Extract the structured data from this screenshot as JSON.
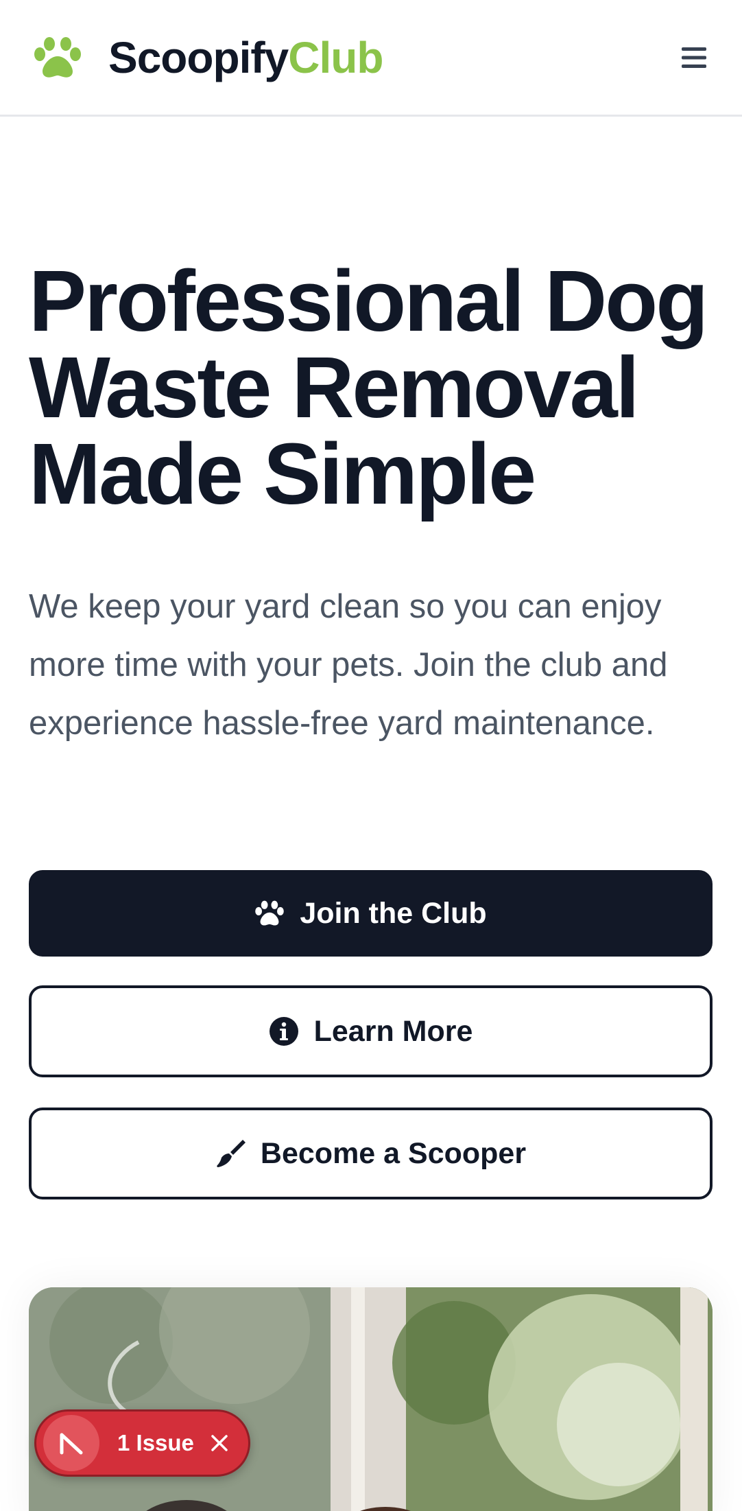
{
  "header": {
    "brand_part1": "Scoopify",
    "brand_part2": "Club",
    "logo_icon": "paw-icon",
    "menu_icon": "hamburger-menu-icon"
  },
  "hero": {
    "title_line1": "Professional Dog",
    "title_line2": "Waste Removal",
    "title_line3": "Made Simple",
    "subtitle": "We keep your yard clean so you can enjoy more time with your pets. Join the club and experience hassle-free yard maintenance."
  },
  "buttons": {
    "join_label": "Join the Club",
    "learn_label": "Learn More",
    "scooper_label": "Become a Scooper"
  },
  "issue_badge": {
    "label": "1 Issue"
  },
  "colors": {
    "brand_dark": "#111827",
    "brand_green": "#8bc34a",
    "body_text": "#4b5563",
    "issue_red": "#d32f3a"
  }
}
